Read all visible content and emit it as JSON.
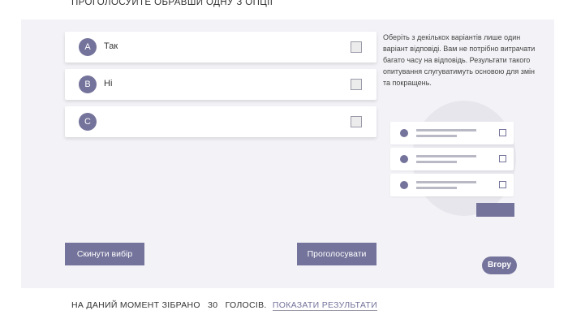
{
  "header": {
    "title": "ПРОГОЛОСУЙТЕ ОБРАВШИ ОДНУ З ОПЦІЇ"
  },
  "options": [
    {
      "letter": "A",
      "label": "Так"
    },
    {
      "letter": "B",
      "label": "Ні"
    },
    {
      "letter": "C",
      "label": ""
    }
  ],
  "hint": "Оберіть з декількох варіантів лише один варіант відповіді. Вам не потрібно витрачати багато часу на відповідь. Результати такого опитування слугуватимуть основою для змін та покращень.",
  "buttons": {
    "reset": "Скинути вибір",
    "vote": "Проголосувати",
    "up": "Вгору"
  },
  "footer": {
    "prefix": "НА ДАНИЙ МОМЕНТ ЗІБРАНО",
    "count": "30",
    "suffix": "ГОЛОСІВ.",
    "link": "ПОКАЗАТИ РЕЗУЛЬТАТИ"
  },
  "colors": {
    "accent": "#74739b",
    "panel": "#f3f3f7"
  }
}
